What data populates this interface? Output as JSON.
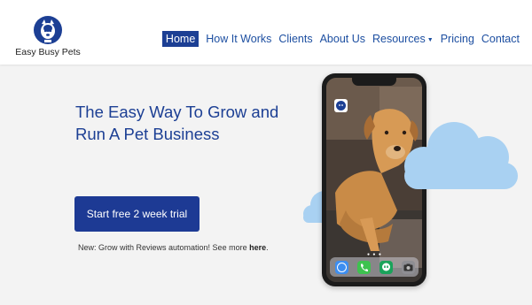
{
  "brand": {
    "name": "Easy Busy Pets"
  },
  "nav": {
    "items": [
      {
        "label": "Home",
        "active": true
      },
      {
        "label": "How It Works"
      },
      {
        "label": "Clients"
      },
      {
        "label": "About Us"
      },
      {
        "label": "Resources",
        "dropdown": true
      },
      {
        "label": "Pricing"
      },
      {
        "label": "Contact"
      }
    ]
  },
  "hero": {
    "headline": "The Easy Way To Grow and Run A Pet Business",
    "cta_label": "Start free 2 week trial",
    "promo_text": "New: Grow with Reviews automation! See more ",
    "promo_link": "here",
    "promo_suffix": "."
  },
  "phone": {
    "dock_icons": [
      "safari-icon",
      "phone-icon",
      "hangouts-icon",
      "camera-icon"
    ]
  },
  "colors": {
    "brand_navy": "#1c3f94",
    "nav_link": "#1d4fa1",
    "cloud": "#a9d1f2",
    "page_bg": "#f3f3f3"
  }
}
